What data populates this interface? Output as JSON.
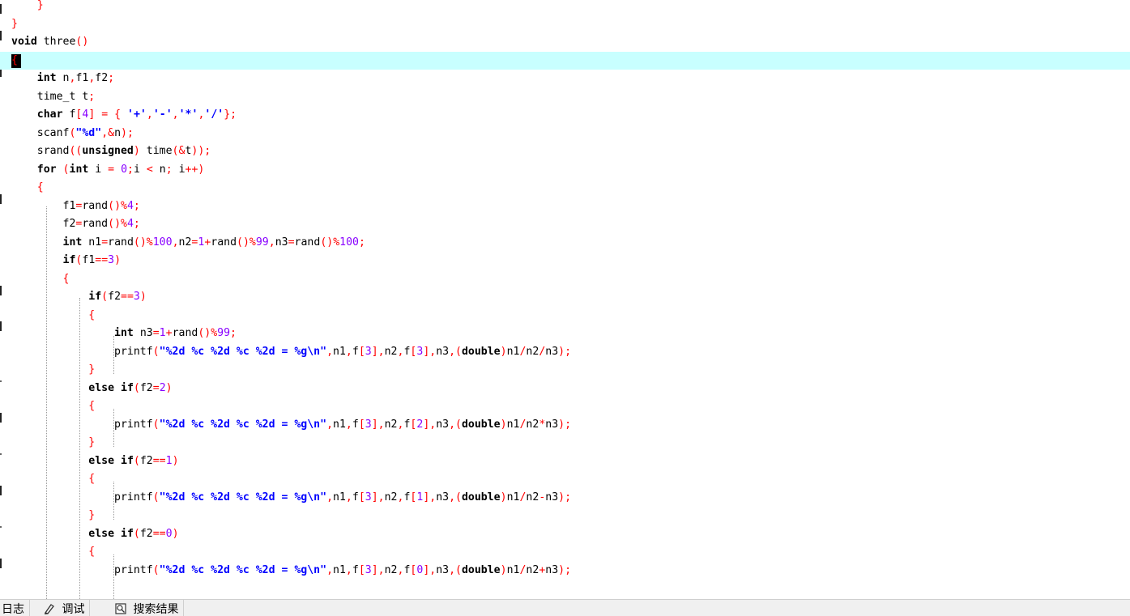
{
  "editor": {
    "lines": [
      [
        [
          "",
          "    "
        ],
        [
          "p",
          "}"
        ]
      ],
      [
        [
          "p",
          "}"
        ]
      ],
      [
        [
          "kw",
          "void"
        ],
        [
          "",
          " three"
        ],
        [
          "p",
          "()"
        ]
      ],
      [
        [
          "p",
          "{"
        ]
      ],
      [
        [
          "",
          "    "
        ],
        [
          "kw",
          "int"
        ],
        [
          "",
          " n"
        ],
        [
          "p",
          ","
        ],
        [
          "",
          "f1"
        ],
        [
          "p",
          ","
        ],
        [
          "",
          "f2"
        ],
        [
          "p",
          ";"
        ]
      ],
      [
        [
          "",
          "    time_t t"
        ],
        [
          "p",
          ";"
        ]
      ],
      [
        [
          "",
          "    "
        ],
        [
          "kw",
          "char"
        ],
        [
          "",
          " f"
        ],
        [
          "p",
          "["
        ],
        [
          "num",
          "4"
        ],
        [
          "p",
          "]"
        ],
        [
          "",
          " "
        ],
        [
          "p",
          "="
        ],
        [
          "",
          " "
        ],
        [
          "p",
          "{"
        ],
        [
          "",
          " "
        ],
        [
          "s",
          "'+'"
        ],
        [
          "p",
          ","
        ],
        [
          "s",
          "'-'"
        ],
        [
          "p",
          ","
        ],
        [
          "s",
          "'*'"
        ],
        [
          "p",
          ","
        ],
        [
          "s",
          "'/'"
        ],
        [
          "p",
          "};"
        ]
      ],
      [
        [
          "",
          "    scanf"
        ],
        [
          "p",
          "("
        ],
        [
          "s",
          "\"%d\""
        ],
        [
          "p",
          ","
        ],
        [
          "p",
          "&"
        ],
        [
          "",
          "n"
        ],
        [
          "p",
          ");"
        ]
      ],
      [
        [
          "",
          "    srand"
        ],
        [
          "p",
          "(("
        ],
        [
          "kw",
          "unsigned"
        ],
        [
          "p",
          ")"
        ],
        [
          "",
          " time"
        ],
        [
          "p",
          "(&"
        ],
        [
          "",
          "t"
        ],
        [
          "p",
          "));"
        ]
      ],
      [
        [
          "",
          "    "
        ],
        [
          "kw",
          "for"
        ],
        [
          "",
          " "
        ],
        [
          "p",
          "("
        ],
        [
          "kw",
          "int"
        ],
        [
          "",
          " i "
        ],
        [
          "p",
          "="
        ],
        [
          "",
          " "
        ],
        [
          "num",
          "0"
        ],
        [
          "p",
          ";"
        ],
        [
          "",
          "i "
        ],
        [
          "p",
          "<"
        ],
        [
          "",
          " n"
        ],
        [
          "p",
          ";"
        ],
        [
          "",
          " i"
        ],
        [
          "p",
          "++)"
        ]
      ],
      [
        [
          "",
          "    "
        ],
        [
          "p",
          "{"
        ]
      ],
      [
        [
          "",
          "        f1"
        ],
        [
          "p",
          "="
        ],
        [
          "",
          "rand"
        ],
        [
          "p",
          "()%"
        ],
        [
          "num",
          "4"
        ],
        [
          "p",
          ";"
        ]
      ],
      [
        [
          "",
          "        f2"
        ],
        [
          "p",
          "="
        ],
        [
          "",
          "rand"
        ],
        [
          "p",
          "()%"
        ],
        [
          "num",
          "4"
        ],
        [
          "p",
          ";"
        ]
      ],
      [
        [
          "",
          "        "
        ],
        [
          "kw",
          "int"
        ],
        [
          "",
          " n1"
        ],
        [
          "p",
          "="
        ],
        [
          "",
          "rand"
        ],
        [
          "p",
          "()%"
        ],
        [
          "num",
          "100"
        ],
        [
          "p",
          ","
        ],
        [
          "",
          "n2"
        ],
        [
          "p",
          "="
        ],
        [
          "num",
          "1"
        ],
        [
          "p",
          "+"
        ],
        [
          "",
          "rand"
        ],
        [
          "p",
          "()%"
        ],
        [
          "num",
          "99"
        ],
        [
          "p",
          ","
        ],
        [
          "",
          "n3"
        ],
        [
          "p",
          "="
        ],
        [
          "",
          "rand"
        ],
        [
          "p",
          "()%"
        ],
        [
          "num",
          "100"
        ],
        [
          "p",
          ";"
        ]
      ],
      [
        [
          "",
          "        "
        ],
        [
          "kw",
          "if"
        ],
        [
          "p",
          "("
        ],
        [
          "",
          "f1"
        ],
        [
          "p",
          "=="
        ],
        [
          "num",
          "3"
        ],
        [
          "p",
          ")"
        ]
      ],
      [
        [
          "",
          "        "
        ],
        [
          "p",
          "{"
        ]
      ],
      [
        [
          "",
          "            "
        ],
        [
          "kw",
          "if"
        ],
        [
          "p",
          "("
        ],
        [
          "",
          "f2"
        ],
        [
          "p",
          "=="
        ],
        [
          "num",
          "3"
        ],
        [
          "p",
          ")"
        ]
      ],
      [
        [
          "",
          "            "
        ],
        [
          "p",
          "{"
        ]
      ],
      [
        [
          "",
          "                "
        ],
        [
          "kw",
          "int"
        ],
        [
          "",
          " n3"
        ],
        [
          "p",
          "="
        ],
        [
          "num",
          "1"
        ],
        [
          "p",
          "+"
        ],
        [
          "",
          "rand"
        ],
        [
          "p",
          "()%"
        ],
        [
          "num",
          "99"
        ],
        [
          "p",
          ";"
        ]
      ],
      [
        [
          "",
          "                printf"
        ],
        [
          "p",
          "("
        ],
        [
          "s",
          "\"%2d %c %2d %c %2d = %g\\n\""
        ],
        [
          "p",
          ","
        ],
        [
          "",
          "n1"
        ],
        [
          "p",
          ","
        ],
        [
          "",
          "f"
        ],
        [
          "p",
          "["
        ],
        [
          "num",
          "3"
        ],
        [
          "p",
          "],"
        ],
        [
          "",
          "n2"
        ],
        [
          "p",
          ","
        ],
        [
          "",
          "f"
        ],
        [
          "p",
          "["
        ],
        [
          "num",
          "3"
        ],
        [
          "p",
          "],"
        ],
        [
          "",
          "n3"
        ],
        [
          "p",
          ",("
        ],
        [
          "kw",
          "double"
        ],
        [
          "p",
          ")"
        ],
        [
          "",
          "n1"
        ],
        [
          "p",
          "/"
        ],
        [
          "",
          "n2"
        ],
        [
          "p",
          "/"
        ],
        [
          "",
          "n3"
        ],
        [
          "p",
          ");"
        ]
      ],
      [
        [
          "",
          "            "
        ],
        [
          "p",
          "}"
        ]
      ],
      [
        [
          "",
          "            "
        ],
        [
          "kw",
          "else"
        ],
        [
          "",
          " "
        ],
        [
          "kw",
          "if"
        ],
        [
          "p",
          "("
        ],
        [
          "",
          "f2"
        ],
        [
          "p",
          "="
        ],
        [
          "num",
          "2"
        ],
        [
          "p",
          ")"
        ]
      ],
      [
        [
          "",
          "            "
        ],
        [
          "p",
          "{"
        ]
      ],
      [
        [
          "",
          "                printf"
        ],
        [
          "p",
          "("
        ],
        [
          "s",
          "\"%2d %c %2d %c %2d = %g\\n\""
        ],
        [
          "p",
          ","
        ],
        [
          "",
          "n1"
        ],
        [
          "p",
          ","
        ],
        [
          "",
          "f"
        ],
        [
          "p",
          "["
        ],
        [
          "num",
          "3"
        ],
        [
          "p",
          "],"
        ],
        [
          "",
          "n2"
        ],
        [
          "p",
          ","
        ],
        [
          "",
          "f"
        ],
        [
          "p",
          "["
        ],
        [
          "num",
          "2"
        ],
        [
          "p",
          "],"
        ],
        [
          "",
          "n3"
        ],
        [
          "p",
          ",("
        ],
        [
          "kw",
          "double"
        ],
        [
          "p",
          ")"
        ],
        [
          "",
          "n1"
        ],
        [
          "p",
          "/"
        ],
        [
          "",
          "n2"
        ],
        [
          "p",
          "*"
        ],
        [
          "",
          "n3"
        ],
        [
          "p",
          ");"
        ]
      ],
      [
        [
          "",
          "            "
        ],
        [
          "p",
          "}"
        ]
      ],
      [
        [
          "",
          "            "
        ],
        [
          "kw",
          "else"
        ],
        [
          "",
          " "
        ],
        [
          "kw",
          "if"
        ],
        [
          "p",
          "("
        ],
        [
          "",
          "f2"
        ],
        [
          "p",
          "=="
        ],
        [
          "num",
          "1"
        ],
        [
          "p",
          ")"
        ]
      ],
      [
        [
          "",
          "            "
        ],
        [
          "p",
          "{"
        ]
      ],
      [
        [
          "",
          "                printf"
        ],
        [
          "p",
          "("
        ],
        [
          "s",
          "\"%2d %c %2d %c %2d = %g\\n\""
        ],
        [
          "p",
          ","
        ],
        [
          "",
          "n1"
        ],
        [
          "p",
          ","
        ],
        [
          "",
          "f"
        ],
        [
          "p",
          "["
        ],
        [
          "num",
          "3"
        ],
        [
          "p",
          "],"
        ],
        [
          "",
          "n2"
        ],
        [
          "p",
          ","
        ],
        [
          "",
          "f"
        ],
        [
          "p",
          "["
        ],
        [
          "num",
          "1"
        ],
        [
          "p",
          "],"
        ],
        [
          "",
          "n3"
        ],
        [
          "p",
          ",("
        ],
        [
          "kw",
          "double"
        ],
        [
          "p",
          ")"
        ],
        [
          "",
          "n1"
        ],
        [
          "p",
          "/"
        ],
        [
          "",
          "n2"
        ],
        [
          "p",
          "-"
        ],
        [
          "",
          "n3"
        ],
        [
          "p",
          ");"
        ]
      ],
      [
        [
          "",
          "            "
        ],
        [
          "p",
          "}"
        ]
      ],
      [
        [
          "",
          "            "
        ],
        [
          "kw",
          "else"
        ],
        [
          "",
          " "
        ],
        [
          "kw",
          "if"
        ],
        [
          "p",
          "("
        ],
        [
          "",
          "f2"
        ],
        [
          "p",
          "=="
        ],
        [
          "num",
          "0"
        ],
        [
          "p",
          ")"
        ]
      ],
      [
        [
          "",
          "            "
        ],
        [
          "p",
          "{"
        ]
      ],
      [
        [
          "",
          "                printf"
        ],
        [
          "p",
          "("
        ],
        [
          "s",
          "\"%2d %c %2d %c %2d = %g\\n\""
        ],
        [
          "p",
          ","
        ],
        [
          "",
          "n1"
        ],
        [
          "p",
          ","
        ],
        [
          "",
          "f"
        ],
        [
          "p",
          "["
        ],
        [
          "num",
          "3"
        ],
        [
          "p",
          "],"
        ],
        [
          "",
          "n2"
        ],
        [
          "p",
          ","
        ],
        [
          "",
          "f"
        ],
        [
          "p",
          "["
        ],
        [
          "num",
          "0"
        ],
        [
          "p",
          "],"
        ],
        [
          "",
          "n3"
        ],
        [
          "p",
          ",("
        ],
        [
          "kw",
          "double"
        ],
        [
          "p",
          ")"
        ],
        [
          "",
          "n1"
        ],
        [
          "p",
          "/"
        ],
        [
          "",
          "n2"
        ],
        [
          "p",
          "+"
        ],
        [
          "",
          "n3"
        ],
        [
          "p",
          ");"
        ]
      ]
    ],
    "current_line_index": 3
  },
  "colors": {
    "current_line": "#c8ffff",
    "keyword": "#000000",
    "operator": "#ff0000",
    "number": "#8800ff",
    "string": "#0000ff"
  },
  "bottom_tabs": [
    {
      "label": "日志",
      "icon": "log-icon"
    },
    {
      "label": "调试",
      "icon": "debug-icon"
    },
    {
      "label": "搜索结果",
      "icon": "search-results-icon"
    }
  ]
}
